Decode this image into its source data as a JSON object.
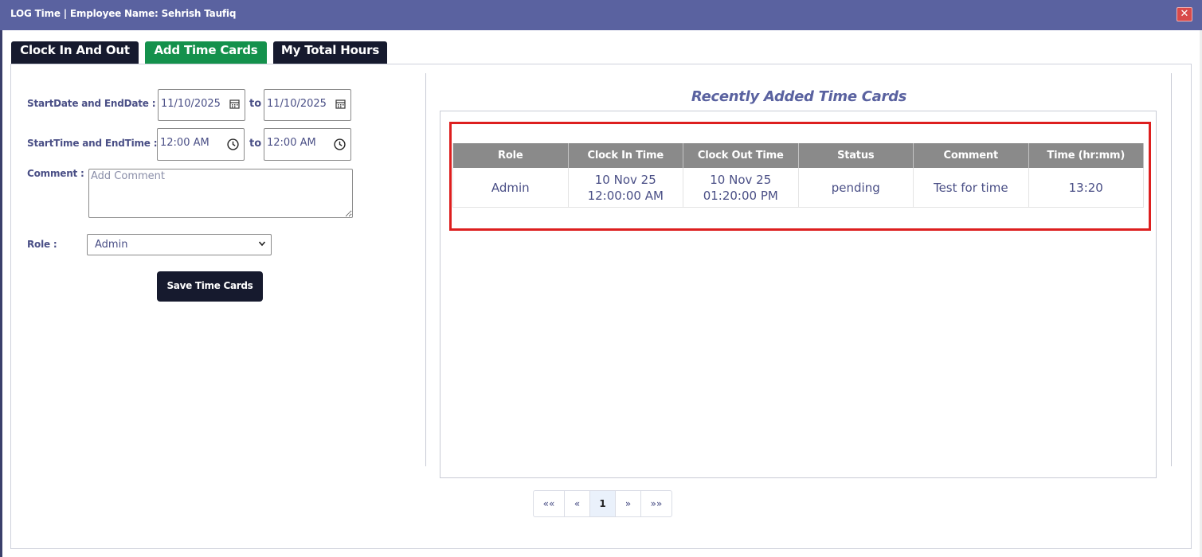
{
  "window": {
    "title": "LOG Time | Employee Name: Sehrish Taufiq",
    "close_glyph": "✕"
  },
  "tabs": [
    {
      "label": "Clock In And Out",
      "active": false
    },
    {
      "label": "Add Time Cards",
      "active": true
    },
    {
      "label": "My Total Hours",
      "active": false
    }
  ],
  "form": {
    "date_label": "StartDate and EndDate :",
    "start_date": "11/10/2025",
    "end_date": "11/10/2025",
    "to_label": "to",
    "time_label": "StartTime and EndTime :",
    "start_time": "12:00  AM",
    "end_time": "12:00  AM",
    "comment_label": "Comment :",
    "comment_placeholder": "Add Comment",
    "role_label": "Role :",
    "role_value": "Admin",
    "save_label": "Save Time Cards"
  },
  "recent": {
    "title": "Recently Added Time Cards",
    "columns": [
      "Role",
      "Clock In Time",
      "Clock Out Time",
      "Status",
      "Comment",
      "Time (hr:mm)"
    ],
    "rows": [
      {
        "role": "Admin",
        "clock_in_date": "10 Nov 25",
        "clock_in_time": "12:00:00 AM",
        "clock_out_date": "10 Nov 25",
        "clock_out_time": "01:20:00 PM",
        "status": "pending",
        "comment": "Test for time",
        "duration": "13:20"
      }
    ]
  },
  "pagination": {
    "first": "««",
    "prev": "«",
    "page": "1",
    "next": "»",
    "last": "»»"
  },
  "colors": {
    "titlebar": "#5a62a0",
    "tab_dark": "#161a2e",
    "tab_active": "#14914c",
    "highlight": "#dd1f1f",
    "table_header": "#8a8a8a"
  }
}
